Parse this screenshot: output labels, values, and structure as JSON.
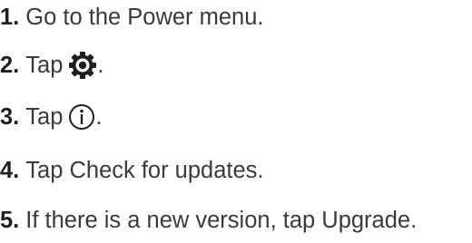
{
  "steps": [
    {
      "number": "1.",
      "text": "Go to the Power menu."
    },
    {
      "number": "2.",
      "text": "Tap",
      "icon": "gear-icon",
      "suffix": "."
    },
    {
      "number": "3.",
      "text": "Tap",
      "icon": "info-circle-icon",
      "suffix": "."
    },
    {
      "number": "4.",
      "text": "Tap Check for updates."
    },
    {
      "number": "5.",
      "text": "If there is a new version, tap Upgrade."
    }
  ]
}
